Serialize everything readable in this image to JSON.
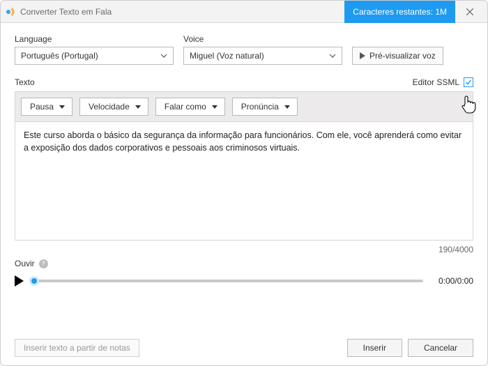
{
  "titlebar": {
    "title": "Converter Texto em Fala",
    "chars_remaining": "Caracteres restantes: 1M"
  },
  "fields": {
    "language_label": "Language",
    "language_value": "Português (Portugal)",
    "voice_label": "Voice",
    "voice_value": "Miguel (Voz natural)",
    "preview_label": "Pré-visualizar voz"
  },
  "text_section": {
    "label": "Texto",
    "editor_ssml_label": "Editor SSML",
    "editor_ssml_checked": true
  },
  "toolbar": {
    "pause": "Pausa",
    "speed": "Velocidade",
    "speak_as": "Falar como",
    "pronunciation": "Pronúncia"
  },
  "textarea": {
    "value": "Este curso aborda o básico da segurança da informação para funcionários. Com ele, você aprenderá como evitar a exposição dos dados corporativos e pessoais aos criminosos virtuais."
  },
  "counter": "190/4000",
  "listen": {
    "label": "Ouvir",
    "help": "?",
    "time": "0:00/0:00"
  },
  "footer": {
    "insert_from_notes": "Inserir texto a partir de notas",
    "insert": "Inserir",
    "cancel": "Cancelar"
  }
}
